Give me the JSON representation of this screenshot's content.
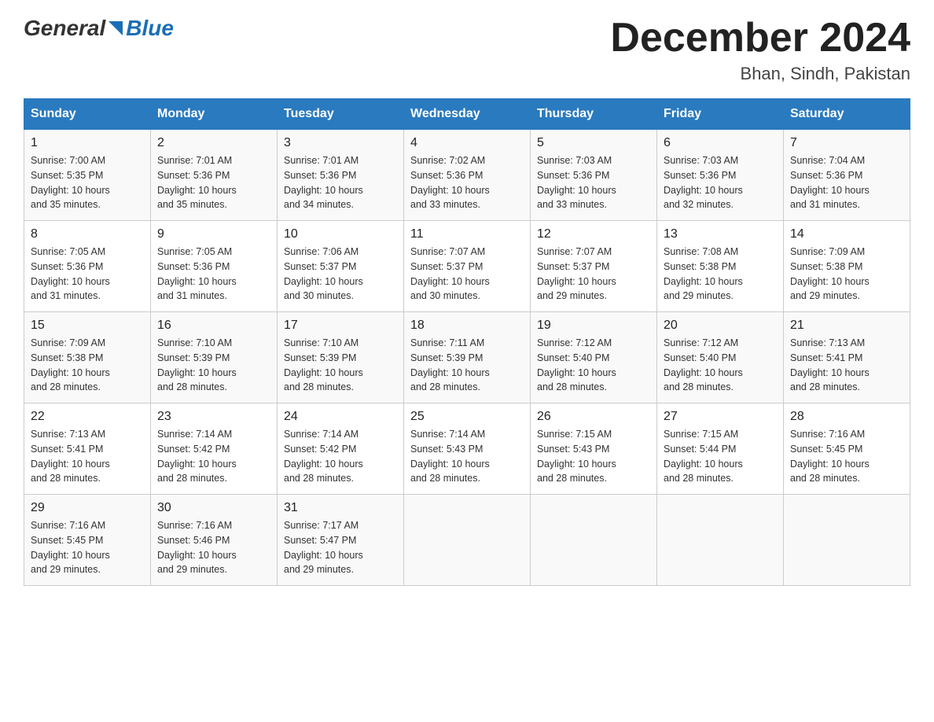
{
  "header": {
    "logo_general": "General",
    "logo_blue": "Blue",
    "month_title": "December 2024",
    "location": "Bhan, Sindh, Pakistan"
  },
  "days_of_week": [
    "Sunday",
    "Monday",
    "Tuesday",
    "Wednesday",
    "Thursday",
    "Friday",
    "Saturday"
  ],
  "weeks": [
    [
      {
        "day": "1",
        "sunrise": "7:00 AM",
        "sunset": "5:35 PM",
        "daylight": "10 hours and 35 minutes."
      },
      {
        "day": "2",
        "sunrise": "7:01 AM",
        "sunset": "5:36 PM",
        "daylight": "10 hours and 35 minutes."
      },
      {
        "day": "3",
        "sunrise": "7:01 AM",
        "sunset": "5:36 PM",
        "daylight": "10 hours and 34 minutes."
      },
      {
        "day": "4",
        "sunrise": "7:02 AM",
        "sunset": "5:36 PM",
        "daylight": "10 hours and 33 minutes."
      },
      {
        "day": "5",
        "sunrise": "7:03 AM",
        "sunset": "5:36 PM",
        "daylight": "10 hours and 33 minutes."
      },
      {
        "day": "6",
        "sunrise": "7:03 AM",
        "sunset": "5:36 PM",
        "daylight": "10 hours and 32 minutes."
      },
      {
        "day": "7",
        "sunrise": "7:04 AM",
        "sunset": "5:36 PM",
        "daylight": "10 hours and 31 minutes."
      }
    ],
    [
      {
        "day": "8",
        "sunrise": "7:05 AM",
        "sunset": "5:36 PM",
        "daylight": "10 hours and 31 minutes."
      },
      {
        "day": "9",
        "sunrise": "7:05 AM",
        "sunset": "5:36 PM",
        "daylight": "10 hours and 31 minutes."
      },
      {
        "day": "10",
        "sunrise": "7:06 AM",
        "sunset": "5:37 PM",
        "daylight": "10 hours and 30 minutes."
      },
      {
        "day": "11",
        "sunrise": "7:07 AM",
        "sunset": "5:37 PM",
        "daylight": "10 hours and 30 minutes."
      },
      {
        "day": "12",
        "sunrise": "7:07 AM",
        "sunset": "5:37 PM",
        "daylight": "10 hours and 29 minutes."
      },
      {
        "day": "13",
        "sunrise": "7:08 AM",
        "sunset": "5:38 PM",
        "daylight": "10 hours and 29 minutes."
      },
      {
        "day": "14",
        "sunrise": "7:09 AM",
        "sunset": "5:38 PM",
        "daylight": "10 hours and 29 minutes."
      }
    ],
    [
      {
        "day": "15",
        "sunrise": "7:09 AM",
        "sunset": "5:38 PM",
        "daylight": "10 hours and 28 minutes."
      },
      {
        "day": "16",
        "sunrise": "7:10 AM",
        "sunset": "5:39 PM",
        "daylight": "10 hours and 28 minutes."
      },
      {
        "day": "17",
        "sunrise": "7:10 AM",
        "sunset": "5:39 PM",
        "daylight": "10 hours and 28 minutes."
      },
      {
        "day": "18",
        "sunrise": "7:11 AM",
        "sunset": "5:39 PM",
        "daylight": "10 hours and 28 minutes."
      },
      {
        "day": "19",
        "sunrise": "7:12 AM",
        "sunset": "5:40 PM",
        "daylight": "10 hours and 28 minutes."
      },
      {
        "day": "20",
        "sunrise": "7:12 AM",
        "sunset": "5:40 PM",
        "daylight": "10 hours and 28 minutes."
      },
      {
        "day": "21",
        "sunrise": "7:13 AM",
        "sunset": "5:41 PM",
        "daylight": "10 hours and 28 minutes."
      }
    ],
    [
      {
        "day": "22",
        "sunrise": "7:13 AM",
        "sunset": "5:41 PM",
        "daylight": "10 hours and 28 minutes."
      },
      {
        "day": "23",
        "sunrise": "7:14 AM",
        "sunset": "5:42 PM",
        "daylight": "10 hours and 28 minutes."
      },
      {
        "day": "24",
        "sunrise": "7:14 AM",
        "sunset": "5:42 PM",
        "daylight": "10 hours and 28 minutes."
      },
      {
        "day": "25",
        "sunrise": "7:14 AM",
        "sunset": "5:43 PM",
        "daylight": "10 hours and 28 minutes."
      },
      {
        "day": "26",
        "sunrise": "7:15 AM",
        "sunset": "5:43 PM",
        "daylight": "10 hours and 28 minutes."
      },
      {
        "day": "27",
        "sunrise": "7:15 AM",
        "sunset": "5:44 PM",
        "daylight": "10 hours and 28 minutes."
      },
      {
        "day": "28",
        "sunrise": "7:16 AM",
        "sunset": "5:45 PM",
        "daylight": "10 hours and 28 minutes."
      }
    ],
    [
      {
        "day": "29",
        "sunrise": "7:16 AM",
        "sunset": "5:45 PM",
        "daylight": "10 hours and 29 minutes."
      },
      {
        "day": "30",
        "sunrise": "7:16 AM",
        "sunset": "5:46 PM",
        "daylight": "10 hours and 29 minutes."
      },
      {
        "day": "31",
        "sunrise": "7:17 AM",
        "sunset": "5:47 PM",
        "daylight": "10 hours and 29 minutes."
      },
      null,
      null,
      null,
      null
    ]
  ],
  "labels": {
    "sunrise": "Sunrise:",
    "sunset": "Sunset:",
    "daylight": "Daylight:"
  }
}
